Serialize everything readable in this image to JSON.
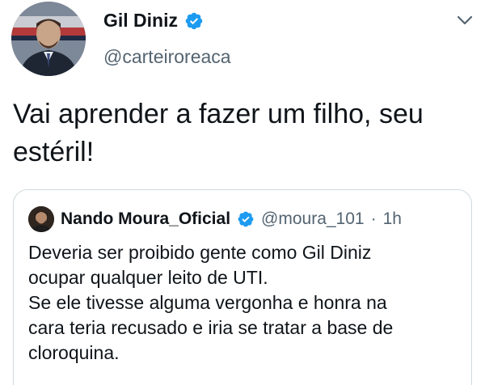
{
  "author": {
    "name": "Gil Diniz",
    "handle": "@carteiroreaca",
    "avatar_icon": "profile-photo",
    "verified_icon": "verified-badge-icon"
  },
  "tweet": {
    "text": "Vai aprender a fazer um filho, seu estéril!"
  },
  "quoted_tweet": {
    "name": "Nando Moura_Oficial",
    "handle": "@moura_101",
    "separator": "·",
    "time": "1h",
    "lines": [
      "Deveria ser proibido gente como Gil Diniz",
      "ocupar qualquer leito de UTI.",
      "Se ele tivesse alguma vergonha e honra na",
      "cara teria recusado e iria se tratar a base de",
      "cloroquina."
    ]
  },
  "colors": {
    "verified": "#1d9bf0",
    "secondary_text": "#536471",
    "border": "#cfd9de"
  },
  "icons": {
    "menu": "chevron-down-icon"
  }
}
